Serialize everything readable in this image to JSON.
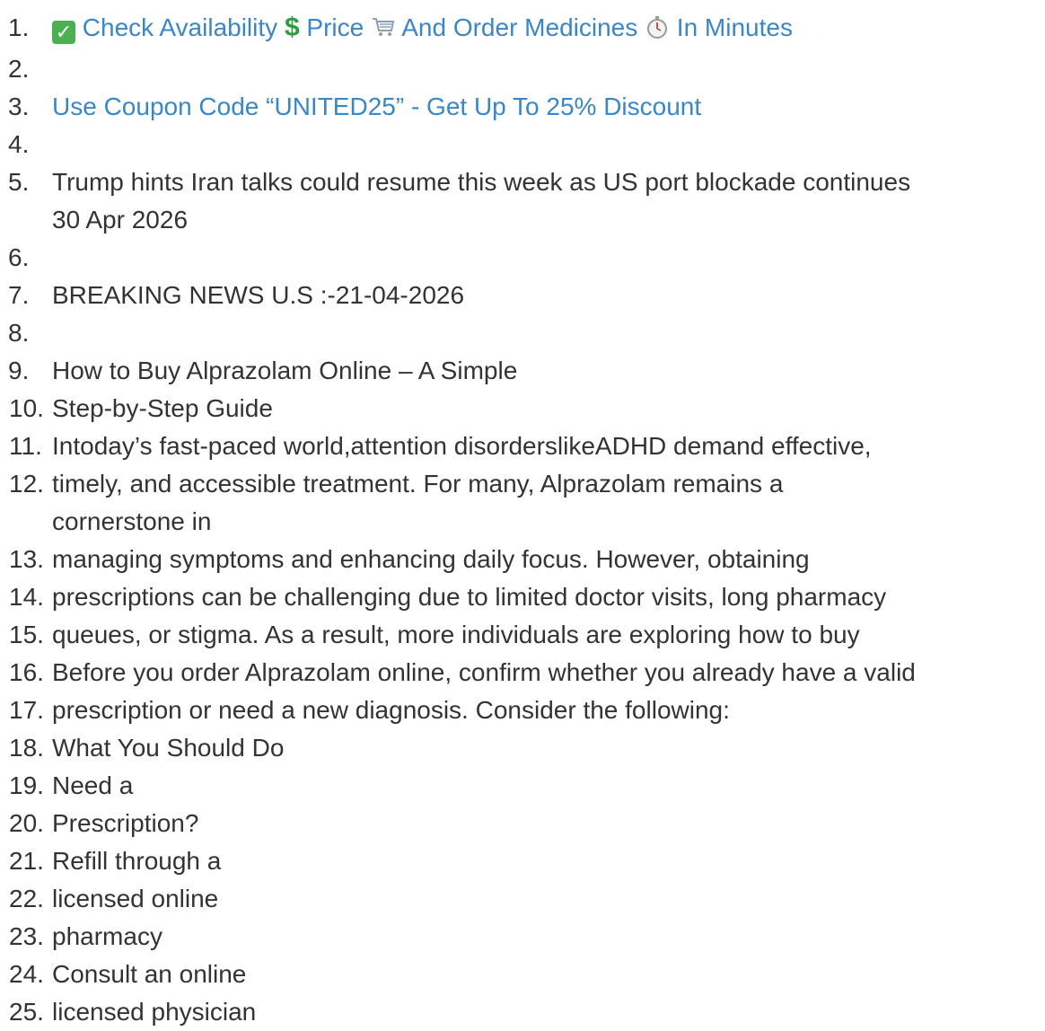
{
  "lines": [
    {
      "n": "1.",
      "parts": [
        "Check Availability",
        "Price",
        "And Order Medicines",
        "In Minutes"
      ]
    },
    {
      "n": "2.",
      "text": ""
    },
    {
      "n": "3.",
      "text": "Use Coupon Code “UNITED25” - Get Up To 25% Discount"
    },
    {
      "n": "4.",
      "text": ""
    },
    {
      "n": "5.",
      "text": "Trump hints Iran talks could resume this week as US port blockade continues",
      "text2": "30 Apr 2026"
    },
    {
      "n": "6.",
      "text": ""
    },
    {
      "n": "7.",
      "text": "BREAKING NEWS U.S :-21-04-2026"
    },
    {
      "n": "8.",
      "text": ""
    },
    {
      "n": "9.",
      "text": "How to Buy Alprazolam Online – A Simple"
    },
    {
      "n": "10.",
      "text": "Step-by-Step Guide"
    },
    {
      "n": "11.",
      "text": "Intoday’s fast-paced world,attention disorderslikeADHD demand effective,"
    },
    {
      "n": "12.",
      "text": "timely, and accessible treatment. For many, Alprazolam remains a",
      "text2": "cornerstone in"
    },
    {
      "n": "13.",
      "text": "managing symptoms and enhancing daily focus. However, obtaining"
    },
    {
      "n": "14.",
      "text": "prescriptions can be challenging due to limited doctor visits, long pharmacy"
    },
    {
      "n": "15.",
      "text": "queues, or stigma. As a result, more individuals are exploring how to buy"
    },
    {
      "n": "16.",
      "text": "Before you order Alprazolam online, confirm whether you already have a valid"
    },
    {
      "n": "17.",
      "text": "prescription or need a new diagnosis. Consider the following:"
    },
    {
      "n": "18.",
      "text": "What You Should Do"
    },
    {
      "n": "19.",
      "text": "Need a"
    },
    {
      "n": "20.",
      "text": "Prescription?"
    },
    {
      "n": "21.",
      "text": "Refill through a"
    },
    {
      "n": "22.",
      "text": "licensed online"
    },
    {
      "n": "23.",
      "text": "pharmacy"
    },
    {
      "n": "24.",
      "text": "Consult an online"
    },
    {
      "n": "25.",
      "text": "licensed physician"
    }
  ],
  "colors": {
    "link": "#3a87c8",
    "text": "#333333",
    "check": "#4caf50",
    "dollar": "#2e9d3e"
  }
}
